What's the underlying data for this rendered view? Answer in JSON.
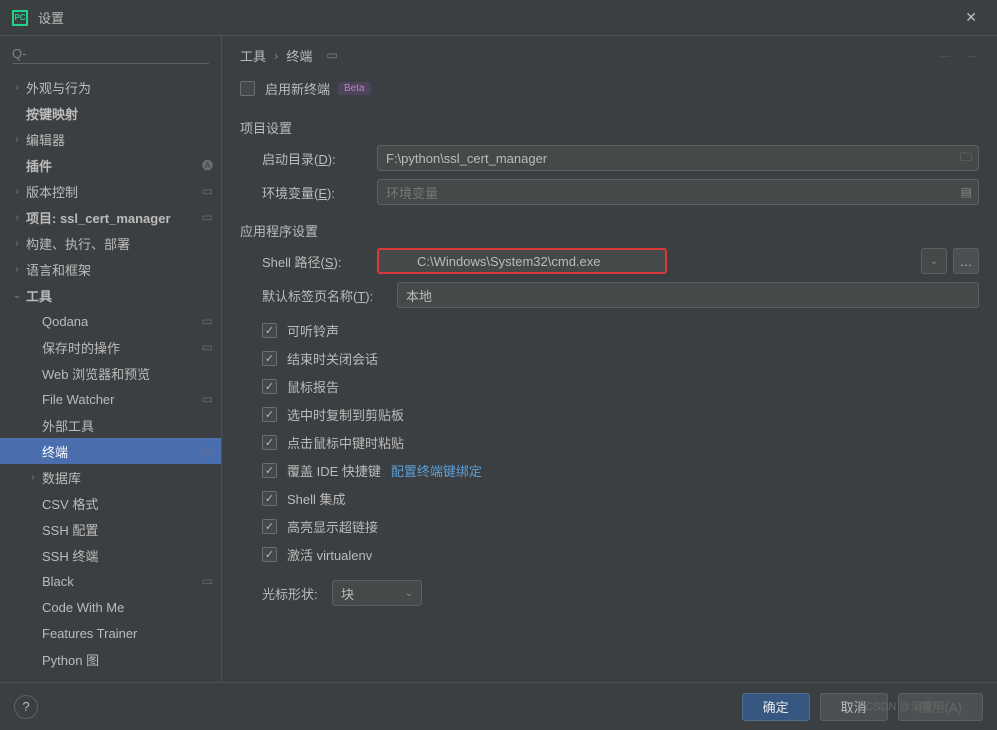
{
  "titlebar": {
    "title": "设置"
  },
  "search": {
    "placeholder": "Q-"
  },
  "sidebar": {
    "items": [
      {
        "label": "外观与行为",
        "depth": 0,
        "arrow": "›"
      },
      {
        "label": "按键映射",
        "depth": 0,
        "arrow": "",
        "bold": true
      },
      {
        "label": "编辑器",
        "depth": 0,
        "arrow": "›"
      },
      {
        "label": "插件",
        "depth": 0,
        "arrow": "",
        "bold": true,
        "ext": "lang"
      },
      {
        "label": "版本控制",
        "depth": 0,
        "arrow": "›",
        "ext": "▭"
      },
      {
        "label": "项目: ssl_cert_manager",
        "depth": 0,
        "arrow": "›",
        "ext": "▭",
        "bold": true
      },
      {
        "label": "构建、执行、部署",
        "depth": 0,
        "arrow": "›"
      },
      {
        "label": "语言和框架",
        "depth": 0,
        "arrow": "›"
      },
      {
        "label": "工具",
        "depth": 0,
        "arrow": "⌄",
        "bold": true
      },
      {
        "label": "Qodana",
        "depth": 1,
        "arrow": "",
        "ext": "▭"
      },
      {
        "label": "保存时的操作",
        "depth": 1,
        "arrow": "",
        "ext": "▭"
      },
      {
        "label": "Web 浏览器和预览",
        "depth": 1,
        "arrow": ""
      },
      {
        "label": "File Watcher",
        "depth": 1,
        "arrow": "",
        "ext": "▭"
      },
      {
        "label": "外部工具",
        "depth": 1,
        "arrow": ""
      },
      {
        "label": "终端",
        "depth": 1,
        "arrow": "",
        "ext": "▭",
        "selected": true
      },
      {
        "label": "数据库",
        "depth": 1,
        "arrow": "›"
      },
      {
        "label": "CSV 格式",
        "depth": 1,
        "arrow": ""
      },
      {
        "label": "SSH 配置",
        "depth": 1,
        "arrow": ""
      },
      {
        "label": "SSH 终端",
        "depth": 1,
        "arrow": ""
      },
      {
        "label": "Black",
        "depth": 1,
        "arrow": "",
        "ext": "▭"
      },
      {
        "label": "Code With Me",
        "depth": 1,
        "arrow": ""
      },
      {
        "label": "Features Trainer",
        "depth": 1,
        "arrow": ""
      },
      {
        "label": "Python 图",
        "depth": 1,
        "arrow": ""
      }
    ]
  },
  "breadcrumb": {
    "parent": "工具",
    "current": "终端"
  },
  "form": {
    "enable_new_terminal": "启用新终端",
    "beta": "Beta",
    "project_settings": "项目设置",
    "start_dir_label": "启动目录(D):",
    "start_dir_value": "F:\\python\\ssl_cert_manager",
    "env_var_label": "环境变量(E):",
    "env_var_placeholder": "环境变量",
    "app_settings": "应用程序设置",
    "shell_path_label": "Shell 路径(S):",
    "shell_path_value": "C:\\Windows\\System32\\cmd.exe",
    "default_tab_label": "默认标签页名称(T):",
    "default_tab_value": "本地",
    "cb_audible": "可听铃声",
    "cb_close_session": "结束时关闭会话",
    "cb_mouse_report": "鼠标报告",
    "cb_copy_select": "选中时复制到剪贴板",
    "cb_middle_paste": "点击鼠标中键时粘贴",
    "cb_override_ide": "覆盖 IDE 快捷键",
    "cb_override_link": "配置终端键绑定",
    "cb_shell_integration": "Shell 集成",
    "cb_highlight_links": "高亮显示超链接",
    "cb_activate_venv": "激活 virtualenv",
    "cursor_shape_label": "光标形状:",
    "cursor_shape_value": "块"
  },
  "footer": {
    "ok": "确定",
    "cancel": "取消",
    "apply": "应用(A)"
  },
  "watermark": "CSDN @渐暖°"
}
